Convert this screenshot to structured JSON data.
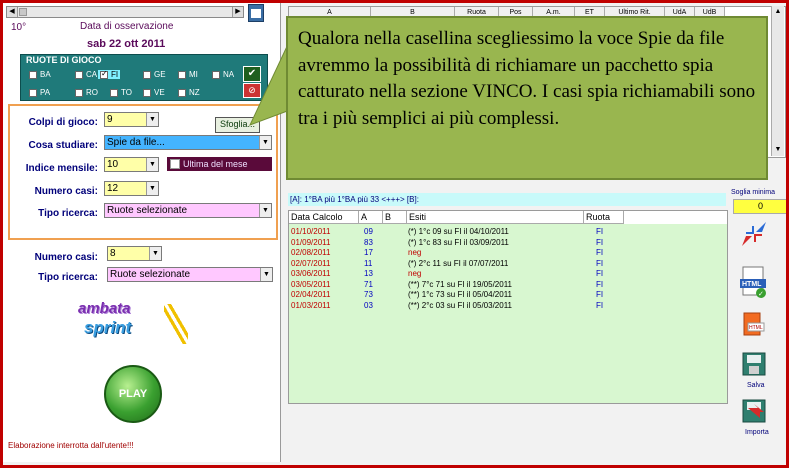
{
  "left": {
    "degree": "10°",
    "data_label": "Data di osservazione",
    "date": "sab 22 ott 2011",
    "ruote_title": "RUOTE DI GIOCO",
    "ruote": [
      {
        "label": "BA",
        "selected": false
      },
      {
        "label": "CA",
        "selected": false
      },
      {
        "label": "FI",
        "selected": true
      },
      {
        "label": "GE",
        "selected": false
      },
      {
        "label": "MI",
        "selected": false
      },
      {
        "label": "NA",
        "selected": false
      },
      {
        "label": "PA",
        "selected": false
      },
      {
        "label": "RO",
        "selected": false
      },
      {
        "label": "TO",
        "selected": false
      },
      {
        "label": "VE",
        "selected": false
      },
      {
        "label": "NZ",
        "selected": false
      }
    ],
    "ok_icon": "check-icon",
    "clear_icon": "eraser-icon",
    "colpi_label": "Colpi di gioco:",
    "colpi_value": "9",
    "sfoglia_label": "Sfoglia...",
    "cosa_label": "Cosa studiare:",
    "cosa_value": "Spie da file...",
    "indice_label": "Indice mensile:",
    "indice_value": "10",
    "ultima_label": "Ultima del mese",
    "numcasi_label": "Numero casi:",
    "numcasi_value": "12",
    "tipo_label": "Tipo ricerca:",
    "tipo_value": "Ruote selezionate",
    "numcasi2_label": "Numero casi:",
    "numcasi2_value": "8",
    "tipo2_label": "Tipo ricerca:",
    "tipo2_value": "Ruote selezionate",
    "logo_line1": "ambata",
    "logo_line2": "sprint",
    "play_label": "PLAY",
    "status": "Elaborazione interrotta dall'utente!!!"
  },
  "grid_top": {
    "headers": [
      "A",
      "B",
      "Ruota",
      "Pos",
      "A.m.",
      "ET",
      "Ultimo Rit.",
      "UdA",
      "UdB"
    ]
  },
  "callout": "Qualora nella casellina scegliessimo la voce Spie da file avremmo la possibilità di richiamare un pacchetto spia catturato nella sezione VINCO. I casi spia richiamabili sono tra i più semplici ai più complessi.",
  "result_line": "[A]: 1°BA più  1°BA  più 33 <+++> [B]:",
  "table": {
    "headers": [
      "Data Calcolo",
      "A",
      "B",
      "Esiti",
      "Ruota"
    ],
    "rows": [
      {
        "date": "01/10/2011",
        "a": "09",
        "b": "",
        "esiti": "(*) 1°c 09 su FI il 04/10/2011",
        "neg": false,
        "ruota": "FI"
      },
      {
        "date": "01/09/2011",
        "a": "83",
        "b": "",
        "esiti": "(*) 1°c 83 su FI il 03/09/2011",
        "neg": false,
        "ruota": "FI"
      },
      {
        "date": "02/08/2011",
        "a": "17",
        "b": "",
        "esiti": "neg",
        "neg": true,
        "ruota": "FI"
      },
      {
        "date": "02/07/2011",
        "a": "11",
        "b": "",
        "esiti": "(*) 2°c 11 su FI il 07/07/2011",
        "neg": false,
        "ruota": "FI"
      },
      {
        "date": "03/06/2011",
        "a": "13",
        "b": "",
        "esiti": "neg",
        "neg": true,
        "ruota": "FI"
      },
      {
        "date": "03/05/2011",
        "a": "71",
        "b": "",
        "esiti": "(**) 7°c 71 su FI il 19/05/2011",
        "neg": false,
        "ruota": "FI"
      },
      {
        "date": "02/04/2011",
        "a": "73",
        "b": "",
        "esiti": "(**) 1°c 73 su FI il 05/04/2011",
        "neg": false,
        "ruota": "FI"
      },
      {
        "date": "01/03/2011",
        "a": "03",
        "b": "",
        "esiti": "(**) 2°c 03 su FI il 05/03/2011",
        "neg": false,
        "ruota": "FI"
      }
    ]
  },
  "right": {
    "soglia_label": "Soglia minima",
    "soglia_value": "0",
    "salva_label": "Salva",
    "importa_label": "Importa",
    "icons": [
      "collapse-arrows-icon",
      "html-export-icon",
      "html-file-icon",
      "save-disk-icon",
      "import-icon"
    ]
  },
  "colors": {
    "frame": "#c00000",
    "callout": "#99b64f",
    "table_bg": "#d8f7d0",
    "ruote_bg": "#1f7a7a"
  }
}
